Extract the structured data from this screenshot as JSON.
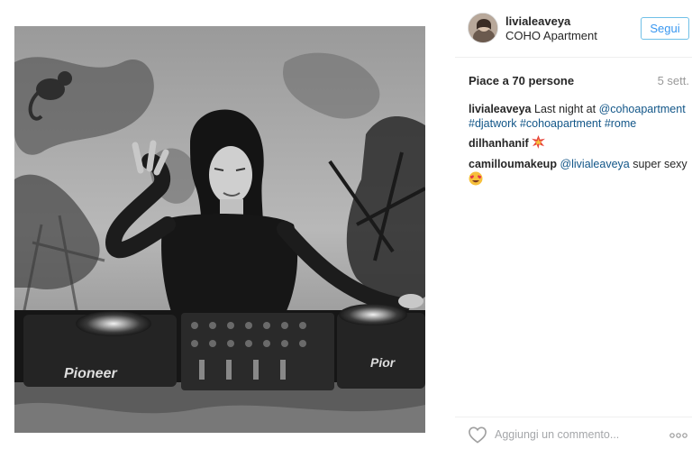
{
  "post": {
    "image_alt_icon": "photo-dj-image",
    "author": {
      "username": "livialeaveya",
      "location": "COHO Apartment",
      "avatar_icon": "avatar-icon"
    },
    "follow_label": "Segui",
    "likes_text": "Piace a 70 persone",
    "time_text": "5 sett.",
    "caption": {
      "user": "livialeaveya",
      "text": "Last night at",
      "mention": "@cohoapartment",
      "hashtags": [
        "#djatwork",
        "#cohoapartment",
        "#rome"
      ]
    },
    "comments": [
      {
        "user": "dilhanhanif",
        "emoji_icon": "collision-emoji-icon"
      },
      {
        "user": "camilloumakeup",
        "mention": "@livialeaveya",
        "text": "super sexy",
        "emoji_icon": "heart-eyes-emoji-icon"
      }
    ],
    "comment_placeholder": "Aggiungi un commento...",
    "like_icon": "heart-outline-icon",
    "more_icon": "more-options-icon"
  },
  "colors": {
    "link": "#125688",
    "follow_blue": "#3897f0",
    "muted": "#999999",
    "text": "#262626"
  }
}
